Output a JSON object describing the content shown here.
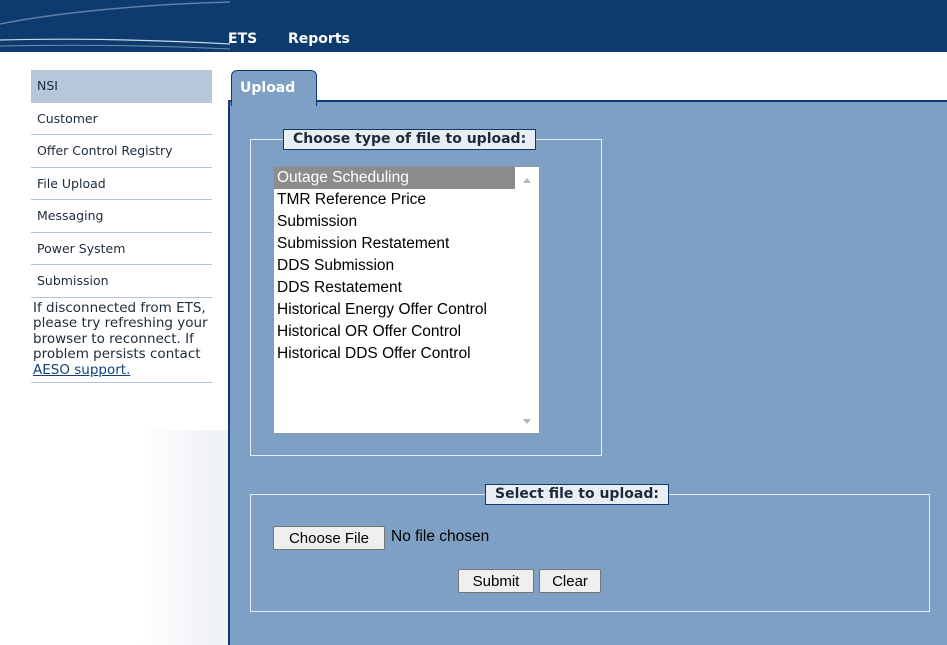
{
  "topnav": {
    "items": [
      {
        "label": "ETS"
      },
      {
        "label": "Reports"
      }
    ]
  },
  "sidebar": {
    "items": [
      {
        "label": "NSI",
        "active": true
      },
      {
        "label": "Customer"
      },
      {
        "label": "Offer Control Registry"
      },
      {
        "label": "File Upload"
      },
      {
        "label": "Messaging"
      },
      {
        "label": "Power System"
      },
      {
        "label": "Submission"
      }
    ],
    "note": {
      "text": "If disconnected from ETS, please try refreshing your browser to reconnect. If problem persists contact ",
      "link": "AESO support."
    }
  },
  "main": {
    "tab_label": "Upload",
    "file_type": {
      "legend": "Choose type of file to upload:",
      "options": [
        "Outage Scheduling",
        "TMR Reference Price",
        "Submission",
        "Submission Restatement",
        "DDS Submission",
        "DDS Restatement",
        "Historical Energy Offer Control",
        "Historical OR Offer Control",
        "Historical DDS Offer Control"
      ],
      "selected": "Outage Scheduling"
    },
    "file_select": {
      "legend": "Select file to upload:",
      "choose_label": "Choose File",
      "status": "No file chosen",
      "submit_label": "Submit",
      "clear_label": "Clear"
    }
  },
  "colors": {
    "header_bg": "#0d3b6e",
    "panel_bg": "#7ea0c4",
    "sidebar_active_bg": "#b7c7d9",
    "selected_option_bg": "#8c8c8c"
  }
}
